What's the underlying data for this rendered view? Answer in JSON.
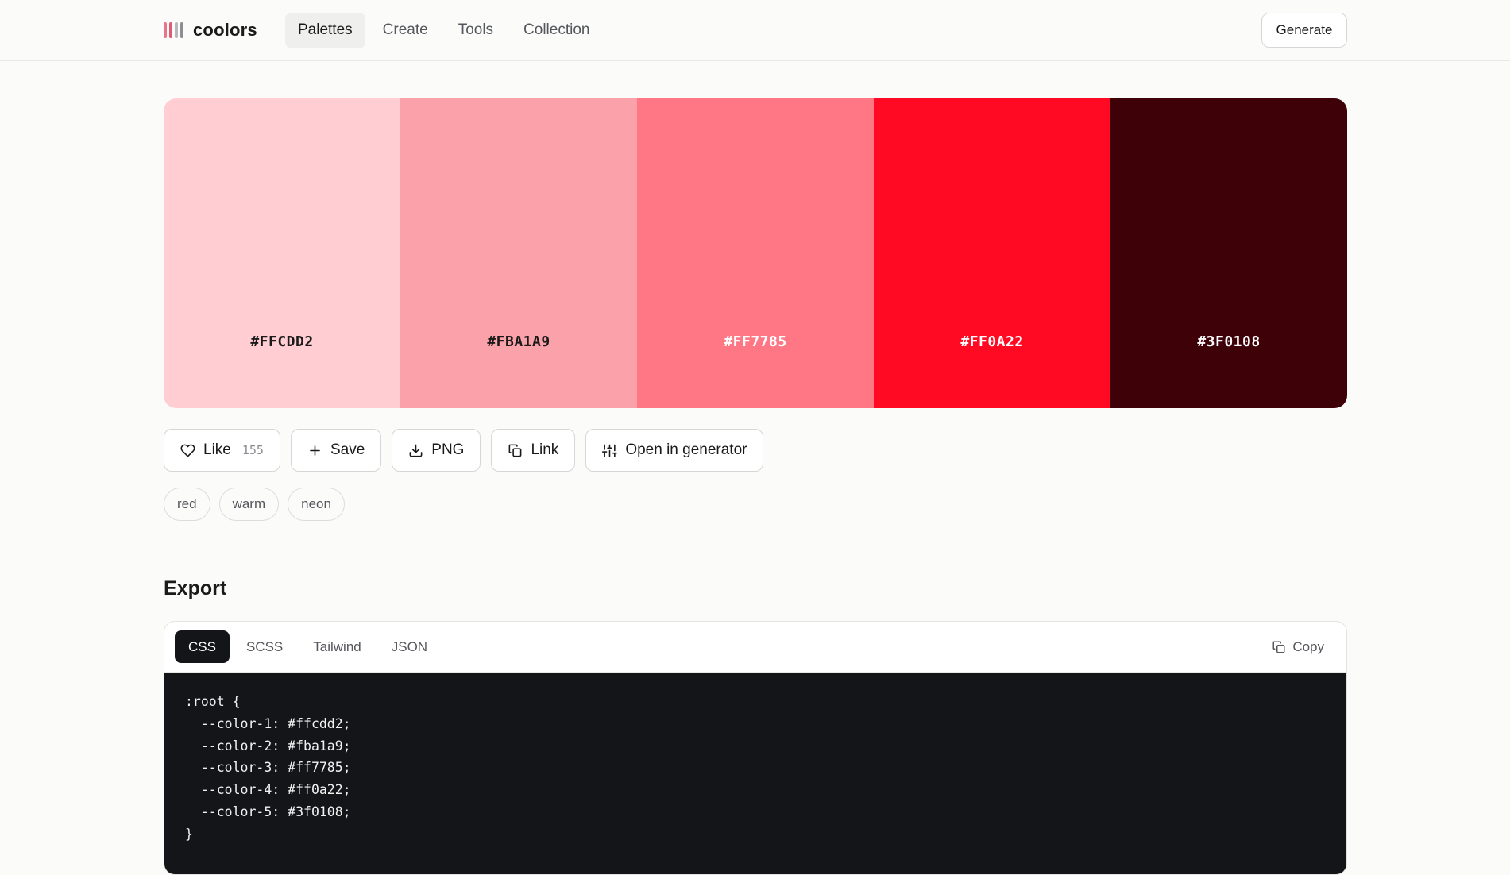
{
  "header": {
    "logo_text": "coolors",
    "logo_colors": [
      "#e9748a",
      "#e05c75",
      "#b8b8bc",
      "#8d8e93"
    ],
    "nav": [
      {
        "label": "Palettes",
        "active": true
      },
      {
        "label": "Create",
        "active": false
      },
      {
        "label": "Tools",
        "active": false
      },
      {
        "label": "Collection",
        "active": false
      }
    ],
    "generate_label": "Generate"
  },
  "palette": {
    "swatches": [
      {
        "hex": "#FFCDD2",
        "text_color": "#1a1a1a"
      },
      {
        "hex": "#FBA1A9",
        "text_color": "#1a1a1a"
      },
      {
        "hex": "#FF7785",
        "text_color": "#ffffff"
      },
      {
        "hex": "#FF0A22",
        "text_color": "#ffffff"
      },
      {
        "hex": "#3F0108",
        "text_color": "#ffffff"
      }
    ]
  },
  "actions": {
    "like_label": "Like",
    "like_count": "155",
    "save_label": "Save",
    "png_label": "PNG",
    "link_label": "Link",
    "open_label": "Open in generator"
  },
  "tags": [
    "red",
    "warm",
    "neon"
  ],
  "export": {
    "title": "Export",
    "tabs": [
      {
        "label": "CSS",
        "active": true
      },
      {
        "label": "SCSS",
        "active": false
      },
      {
        "label": "Tailwind",
        "active": false
      },
      {
        "label": "JSON",
        "active": false
      }
    ],
    "copy_label": "Copy",
    "code": ":root {\n  --color-1: #ffcdd2;\n  --color-2: #fba1a9;\n  --color-3: #ff7785;\n  --color-4: #ff0a22;\n  --color-5: #3f0108;\n}"
  }
}
